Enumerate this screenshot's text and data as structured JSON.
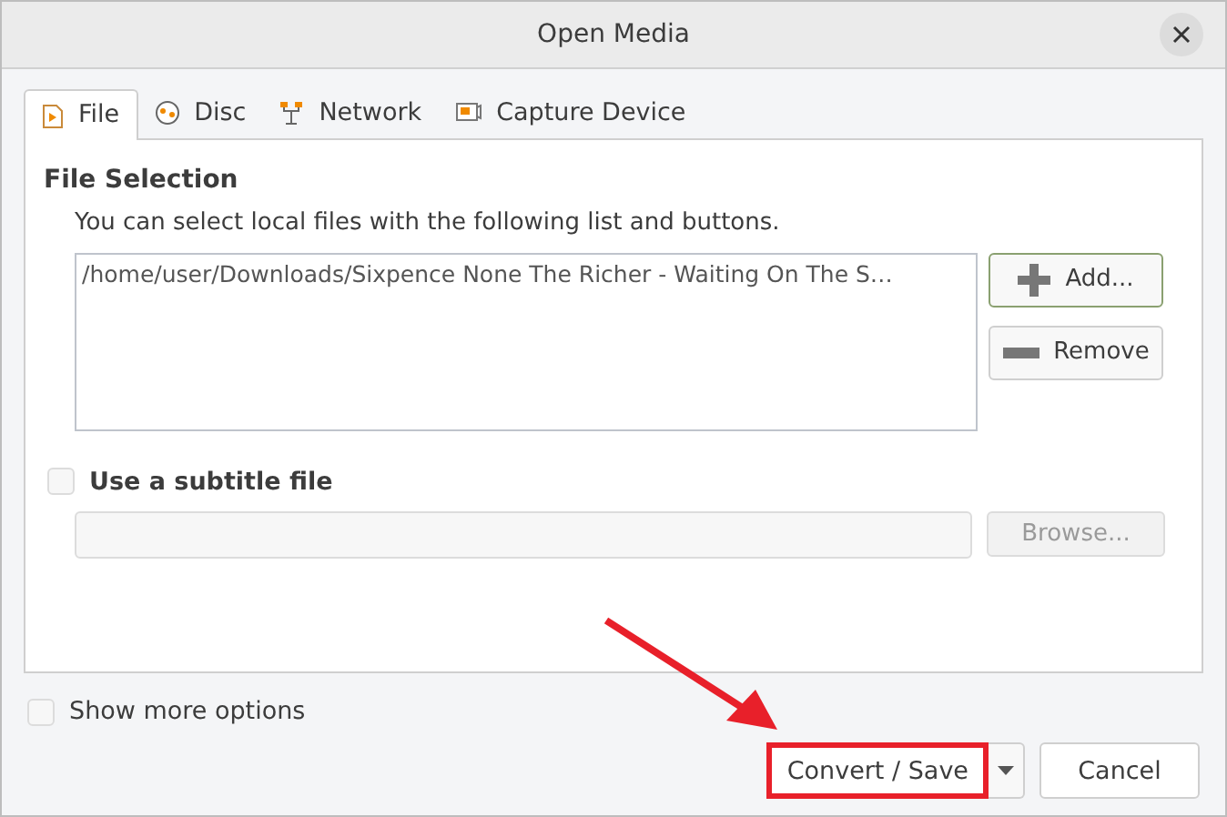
{
  "window": {
    "title": "Open Media"
  },
  "tabs": [
    {
      "label": "File",
      "selected": true,
      "kind": "file"
    },
    {
      "label": "Disc",
      "selected": false,
      "kind": "disc"
    },
    {
      "label": "Network",
      "selected": false,
      "kind": "network"
    },
    {
      "label": "Capture Device",
      "selected": false,
      "kind": "capture"
    }
  ],
  "file_selection": {
    "heading": "File Selection",
    "description": "You can select local files with the following list and buttons.",
    "files": [
      "/home/user/Downloads/Sixpence None The Richer - Waiting On The S…"
    ],
    "add_button": "Add...",
    "remove_button": "Remove"
  },
  "subtitle": {
    "label": "Use a subtitle file",
    "checked": false,
    "browse_button": "Browse...",
    "disabled": true
  },
  "show_more_options": {
    "label": "Show more options",
    "checked": false
  },
  "buttons": {
    "convert": {
      "label": "Convert / Save",
      "highlighted": true
    },
    "cancel": "Cancel"
  }
}
